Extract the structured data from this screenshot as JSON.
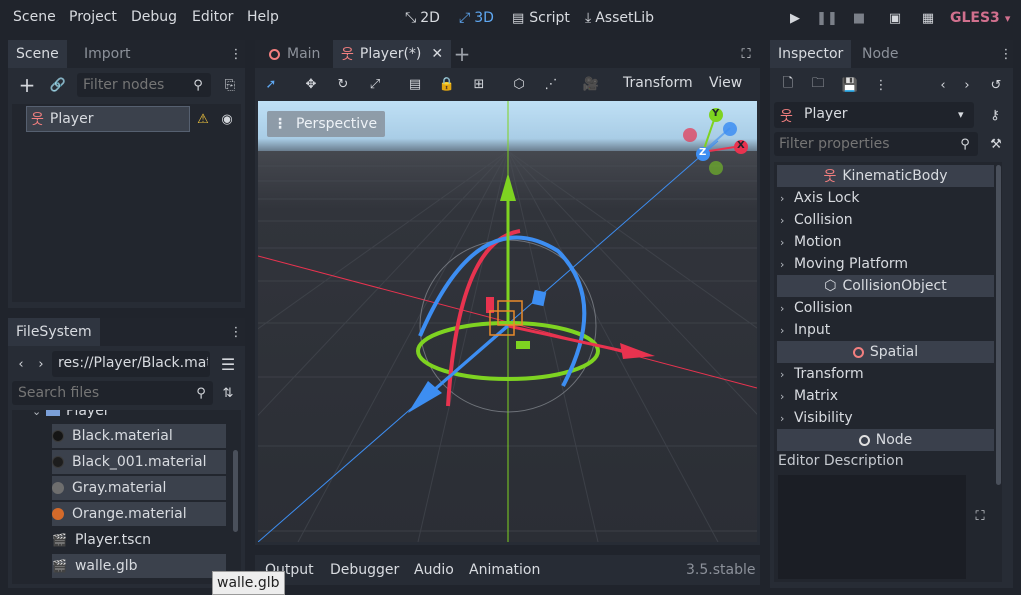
{
  "menu": {
    "items": [
      "Scene",
      "Project",
      "Debug",
      "Editor",
      "Help"
    ],
    "workspaces": {
      "d2": "2D",
      "d3": "3D",
      "script": "Script",
      "assetlib": "AssetLib"
    },
    "renderer": "GLES3"
  },
  "scene_dock": {
    "tabs": [
      "Scene",
      "Import"
    ],
    "filter_placeholder": "Filter nodes",
    "root_node": "Player"
  },
  "filesystem": {
    "tab": "FileSystem",
    "path": "res://Player/Black.mat",
    "search_placeholder": "Search files",
    "folder": "Player",
    "files": [
      {
        "name": "Black.material",
        "color": "#151515"
      },
      {
        "name": "Black_001.material",
        "color": "#1d1d1d"
      },
      {
        "name": "Gray.material",
        "color": "#6e6e6e"
      },
      {
        "name": "Orange.material",
        "color": "#d46a2a"
      },
      {
        "name": "Player.tscn",
        "color": ""
      },
      {
        "name": "walle.glb",
        "color": ""
      }
    ],
    "tooltip": "walle.glb"
  },
  "viewport": {
    "tabs": {
      "main": "Main",
      "player": "Player(*)"
    },
    "toolbar": {
      "transform": "Transform",
      "view": "View"
    },
    "perspective": "Perspective",
    "gizmo_axes": {
      "y": "Y",
      "x": "X",
      "z": "Z"
    },
    "colors": {
      "x": "#e8334f",
      "y": "#7ed321",
      "z": "#3d8ef2",
      "sky": "#b7dbf1",
      "ground": "#2c2f36"
    }
  },
  "bottom": {
    "tabs": [
      "Output",
      "Debugger",
      "Audio",
      "Animation"
    ],
    "version": "3.5.stable"
  },
  "inspector": {
    "tabs": [
      "Inspector",
      "Node"
    ],
    "object": "Player",
    "filter_placeholder": "Filter properties",
    "sections": {
      "kinematic": "KinematicBody",
      "kinematic_items": [
        "Axis Lock",
        "Collision",
        "Motion",
        "Moving Platform"
      ],
      "collision_object": "CollisionObject",
      "collision_items": [
        "Collision",
        "Input"
      ],
      "spatial": "Spatial",
      "spatial_items": [
        "Transform",
        "Matrix",
        "Visibility"
      ],
      "node": "Node",
      "editor_description": "Editor Description"
    }
  }
}
